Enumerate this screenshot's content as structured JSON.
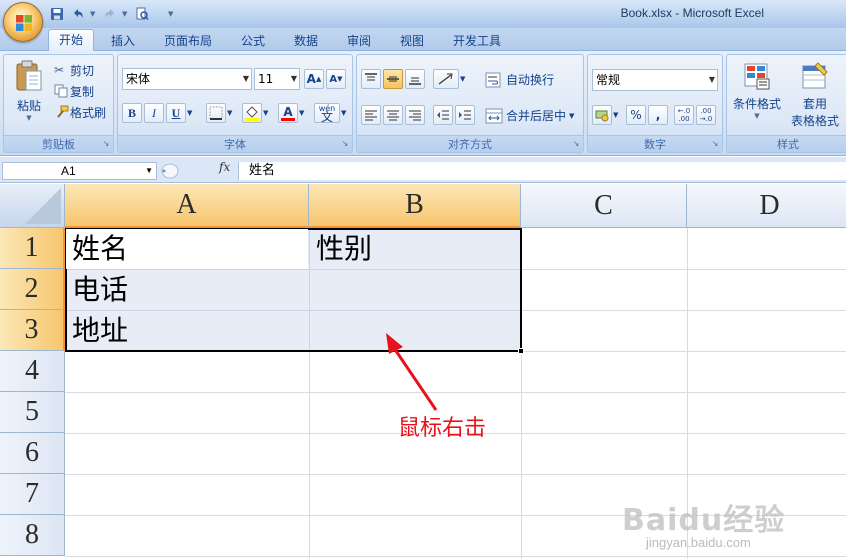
{
  "window": {
    "title": "Book.xlsx - Microsoft Excel"
  },
  "tabs": [
    {
      "label": "开始",
      "active": true
    },
    {
      "label": "插入"
    },
    {
      "label": "页面布局"
    },
    {
      "label": "公式"
    },
    {
      "label": "数据"
    },
    {
      "label": "审阅"
    },
    {
      "label": "视图"
    },
    {
      "label": "开发工具"
    }
  ],
  "ribbon": {
    "clipboard": {
      "label": "剪贴板",
      "paste": "粘贴",
      "cut": "剪切",
      "copy": "复制",
      "format_painter": "格式刷"
    },
    "font": {
      "label": "字体",
      "font_name": "宋体",
      "font_size": "11",
      "bold": "B",
      "italic": "I",
      "underline": "U",
      "grow": "A",
      "shrink": "A",
      "font_color_glyph": "A",
      "phonetic": "wén"
    },
    "alignment": {
      "label": "对齐方式",
      "wrap_text": "自动换行",
      "merge_center": "合并后居中"
    },
    "number": {
      "label": "数字",
      "format": "常规",
      "percent": "%",
      "comma": ",",
      "inc_decimal": ".00",
      "dec_decimal": ".00"
    },
    "styles": {
      "label": "样式",
      "conditional_format": "条件格式",
      "table_format_line1": "套用",
      "table_format_line2": "表格格式"
    }
  },
  "formula_bar": {
    "name_box": "A1",
    "fx": "fx",
    "content": "姓名"
  },
  "sheet": {
    "columns": [
      "A",
      "B",
      "C",
      "D"
    ],
    "rows": [
      "1",
      "2",
      "3",
      "4",
      "5",
      "6",
      "7",
      "8"
    ],
    "cells": {
      "A1": "姓名",
      "B1": "性别",
      "A2": "电话",
      "A3": "地址"
    },
    "selected_range": "A1:B3"
  },
  "annotation": {
    "text": "鼠标右击",
    "color": "#e8121c"
  },
  "watermark": {
    "main": "Baidu经验",
    "sub": "jingyan.baidu.com"
  }
}
